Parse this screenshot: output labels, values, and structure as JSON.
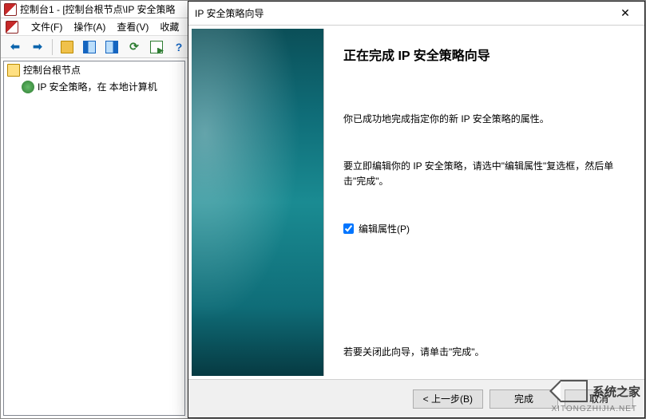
{
  "mmc": {
    "title": "控制台1 - [控制台根节点\\IP 安全策略",
    "menu": {
      "file": "文件(F)",
      "action": "操作(A)",
      "view": "查看(V)",
      "favorites": "收藏"
    },
    "tree": {
      "root": "控制台根节点",
      "child": "IP 安全策略，在 本地计算机"
    }
  },
  "wizard": {
    "title": "IP 安全策略向导",
    "heading": "正在完成 IP 安全策略向导",
    "success_text": "你已成功地完成指定你的新 IP 安全策略的属性。",
    "edit_hint": "要立即编辑你的 IP 安全策略，请选中\"编辑属性\"复选框，然后单击\"完成\"。",
    "checkbox_label": "编辑属性(P)",
    "checkbox_checked": true,
    "close_hint": "若要关闭此向导，请单击\"完成\"。",
    "buttons": {
      "back": "< 上一步(B)",
      "finish": "完成",
      "cancel": "取消"
    }
  },
  "watermark": {
    "text": "系统之家",
    "sub": "XITONGZHIJIA.NET"
  }
}
